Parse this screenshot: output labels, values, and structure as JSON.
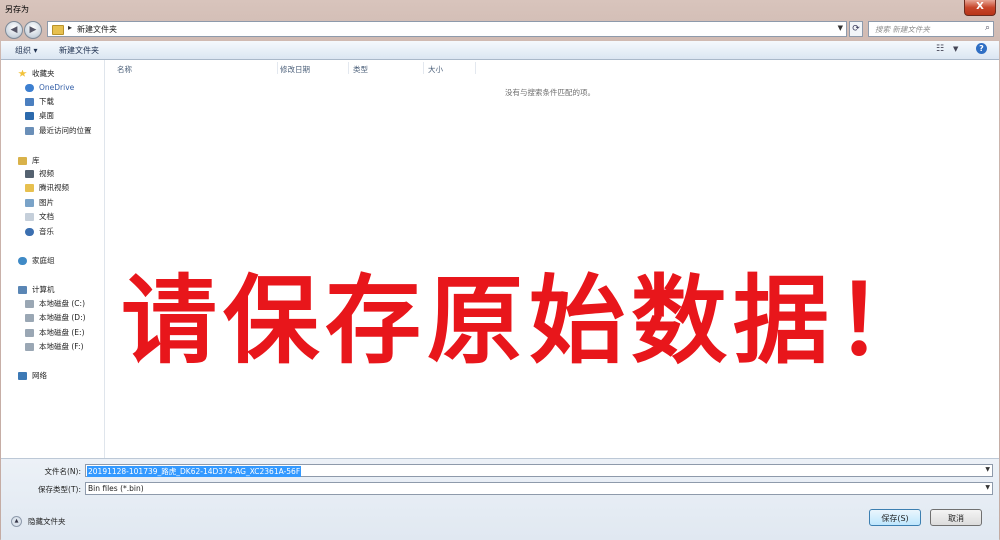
{
  "window": {
    "title": "另存为",
    "close_label": "X"
  },
  "address_bar": {
    "path": "新建文件夹",
    "separator": "▸"
  },
  "search": {
    "placeholder": "搜索 新建文件夹"
  },
  "toolbar": {
    "organize_label": "组织 ▾",
    "new_folder_label": "新建文件夹",
    "help_label": "?"
  },
  "nav_pane": {
    "favorites_header": "收藏夹",
    "favorites": [
      "OneDrive",
      "下载",
      "桌面",
      "最近访问的位置"
    ],
    "library_header": "库",
    "library": [
      "视频",
      "腾讯视频",
      "图片",
      "文档",
      "音乐"
    ],
    "homegroup": "家庭组",
    "computer_header": "计算机",
    "drives": [
      "本地磁盘 (C:)",
      "本地磁盘 (D:)",
      "本地磁盘 (E:)",
      "本地磁盘 (F:)"
    ],
    "network": "网络"
  },
  "file_list": {
    "columns": [
      "名称",
      "修改日期",
      "类型",
      "大小"
    ],
    "empty_message": "没有与搜索条件匹配的项。"
  },
  "overlay_text": "请保存原始数据！",
  "bottom": {
    "filename_label": "文件名(N):",
    "filename_value": "20191128-101739_路虎_DK62-14D374-AG_XC2361A-56F",
    "filetype_label": "保存类型(T):",
    "filetype_value": "Bin files (*.bin)",
    "hide_folders_label": "隐藏文件夹",
    "save_label": "保存(S)",
    "cancel_label": "取消"
  }
}
